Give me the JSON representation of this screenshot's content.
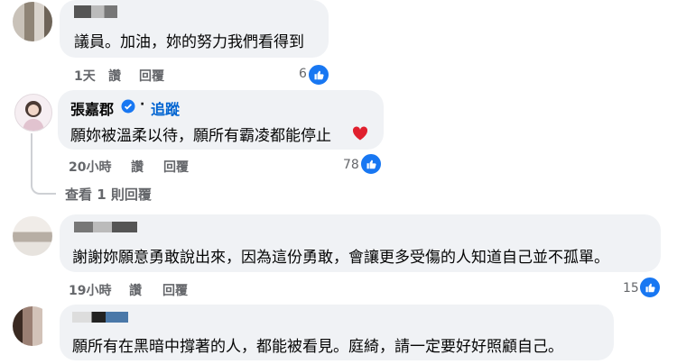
{
  "comments": [
    {
      "author": "",
      "text": "議員。加油，妳的努力我們看得到",
      "time": "1天",
      "like": "讚",
      "reply": "回覆",
      "likes": "6"
    },
    {
      "author": "張嘉郡",
      "verified": true,
      "follow": "追蹤",
      "text": "願妳被溫柔以待，願所有霸凌都能停止",
      "emoji": "heart",
      "time": "20小時",
      "like": "讚",
      "reply": "回覆",
      "likes": "78"
    },
    {
      "author": "",
      "text": "謝謝妳願意勇敢說出來，因為這份勇敢，會讓更多受傷的人知道自己並不孤單。",
      "time": "19小時",
      "like": "讚",
      "reply": "回覆",
      "likes": "15"
    },
    {
      "author": "",
      "text": "願所有在黑暗中撐著的人，都能被看見。庭綺，請一定要好好照顧自己。"
    }
  ],
  "view_replies": "查看 1 則回覆",
  "colors": {
    "like_blue": "#1877f2",
    "bubble": "#f0f2f5",
    "meta": "#65676b"
  }
}
